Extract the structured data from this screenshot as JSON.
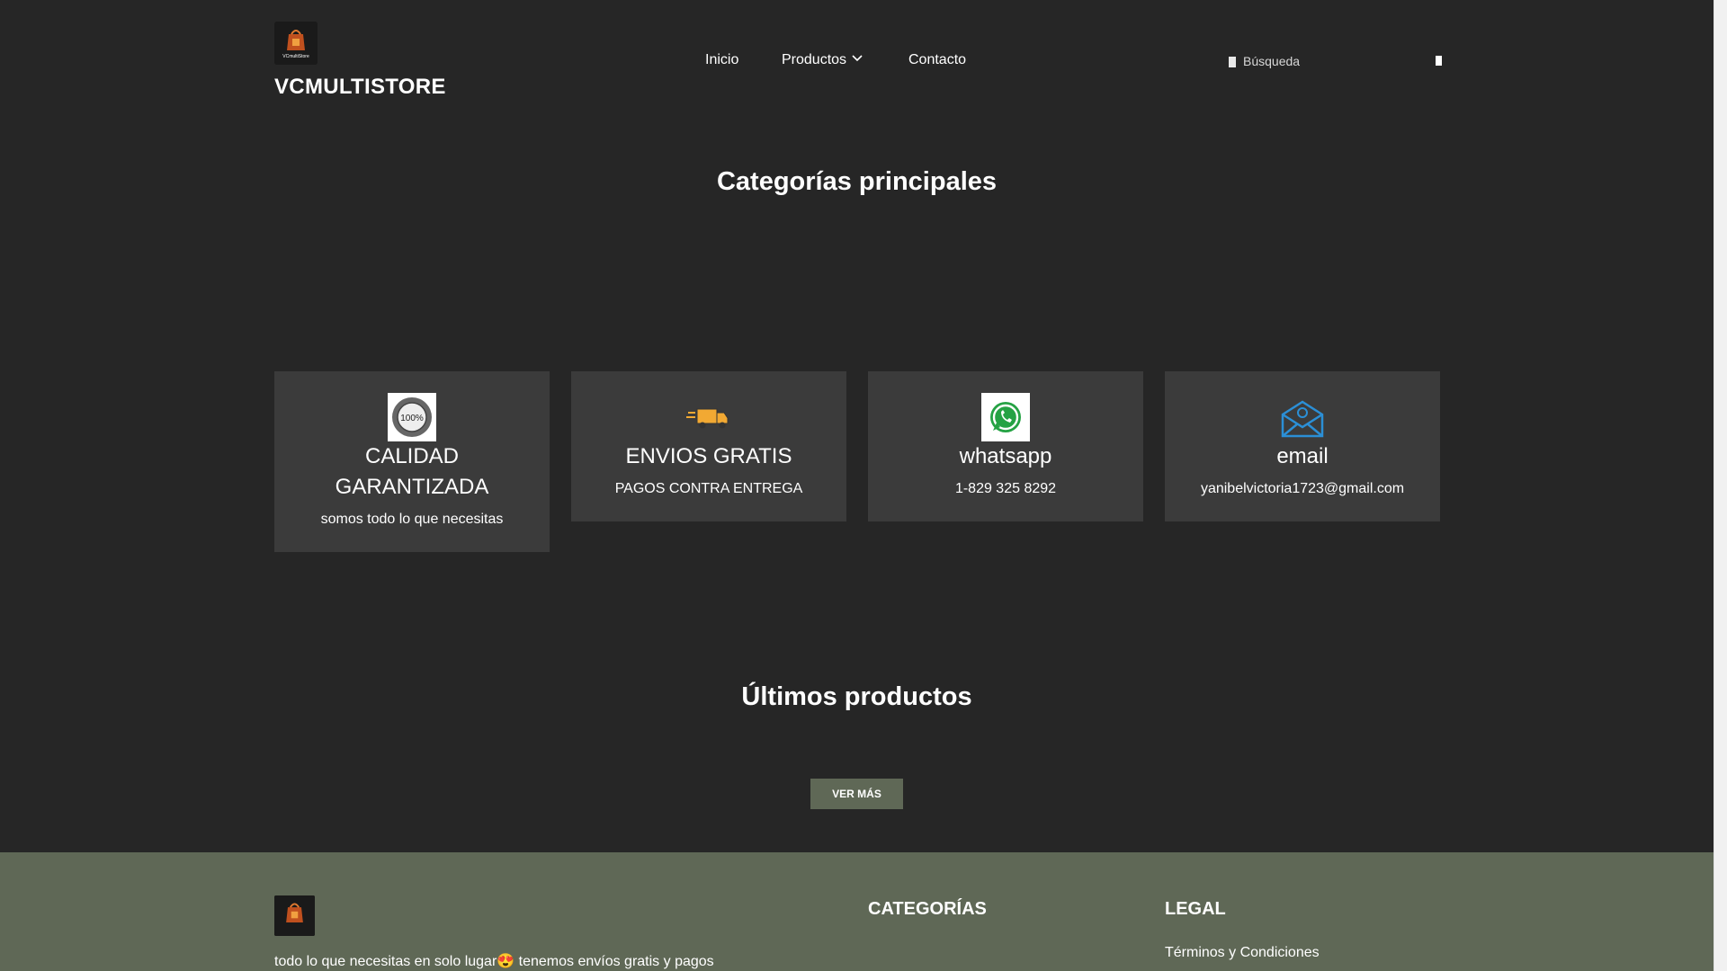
{
  "header": {
    "brand": "VCMULTISTORE",
    "logo_caption": "VCmultiStore",
    "nav": [
      {
        "label": "Inicio"
      },
      {
        "label": "Productos"
      },
      {
        "label": "Contacto"
      }
    ],
    "search_placeholder": "Búsqueda"
  },
  "main": {
    "categories_title": "Categorías principales",
    "features": [
      {
        "title_line1": "CALIDAD",
        "title_line2": "GARANTIZADA",
        "desc": "somos todo lo que necesitas",
        "icon": "quality-seal-icon"
      },
      {
        "title_line1": "ENVIOS GRATIS",
        "desc": "PAGOS CONTRA ENTREGA",
        "icon": "delivery-truck-icon"
      },
      {
        "title_line1": "whatsapp",
        "desc": "1-829 325 8292",
        "icon": "whatsapp-icon"
      },
      {
        "title_line1": "email",
        "desc": "yanibelvictoria1723@gmail.com",
        "icon": "email-icon"
      }
    ],
    "latest_title": "Últimos productos",
    "see_more": "VER MÁS"
  },
  "footer": {
    "text": "todo lo que necesitas en solo lugar😍 tenemos envíos gratis y pagos",
    "categories_heading": "CATEGORÍAS",
    "legal_heading": "LEGAL",
    "terms_link": "Términos y Condiciones"
  },
  "colors": {
    "background": "#262626",
    "card": "#3b3b3b",
    "accent": "#5f6856"
  }
}
